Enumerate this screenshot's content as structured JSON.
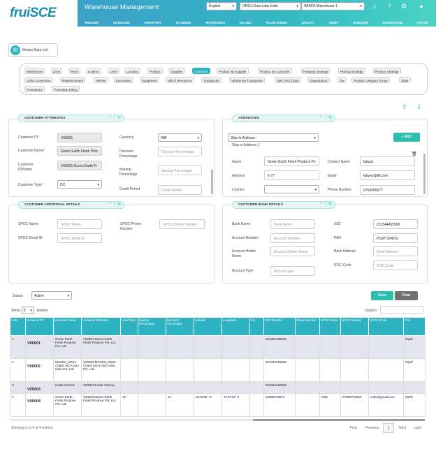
{
  "header": {
    "logo": "fruiSCE",
    "app_title": "Warehouse Management",
    "language": "English",
    "org": "ORG1:Data Labz India",
    "warehouse": "WH001:Warehouse 1",
    "nav": [
      "INBOUND",
      "OUTBOUND",
      "INVENTORY",
      "PLANNING",
      "WORKFORCE",
      "BILLING",
      "VALUE-ADDED",
      "QUALITY",
      "ASSET",
      "BARCODE",
      "INTEGRATION",
      "LAYOUT"
    ]
  },
  "master_data_list": "Master Data List",
  "tabs": [
    "Warehouse",
    "Zone",
    "Rack",
    "Column",
    "Level",
    "Location",
    "Product",
    "Supplier",
    "Customer",
    "Product By Supplier",
    "Product By Customer",
    "Putaway Strategy",
    "Picking Strategy",
    "Product Strategy",
    "UOM Conversion",
    "Replenishment",
    "Vehicle",
    "Executives",
    "Equipment",
    "Bill of Resources",
    "Transporter",
    "Vehicle By Transporter",
    "ABC-XYZ Class",
    "Organization",
    "Tax",
    "Product Category Group",
    "State",
    "Promotions",
    "Promotion Policy"
  ],
  "active_tab": "Customer",
  "customer_attributes": {
    "title": "CUSTOMER ATTRIBUTES",
    "customer_id_label": "Customer ID",
    "customer_id": "V00001",
    "customer_name_label": "Customer Name",
    "customer_name": "Green Earth Fresh Proc",
    "customer_idname_label": "Customer ID/Name",
    "customer_idname": "V00001:Green Earth Fr",
    "customer_type_label": "Customer Type",
    "customer_type": "DC",
    "currency_label": "Currency",
    "currency": "INR",
    "discount_label": "Discount Percentage",
    "discount_placeholder": "Discount Percentage",
    "markup_label": "Markup Percentage",
    "markup_placeholder": "Markup Percentage",
    "credit_label": "Credit Period",
    "credit_placeholder": "Credit Period"
  },
  "addresses": {
    "title": "ADDRESSES",
    "ship_select": "Ship to Address",
    "add_btn": "+ ADD",
    "ship_heading": "Ship to Address 1:",
    "name_label": "Name",
    "name": "Green Earth Fresh Produce Pv",
    "address_label": "Address",
    "address": "6-77",
    "country_label": "Country",
    "contact_label": "Contact Name",
    "contact": "kalyan",
    "email_label": "Email",
    "email": "kalyan@dll.com",
    "phone_label": "Phone Number",
    "phone": "9766566577"
  },
  "additional": {
    "title": "CUSTOMER ADDITIONAL DETAILS",
    "spoc_name_label": "SPOC Name",
    "spoc_name_ph": "SPOC Name",
    "spoc_phone_label": "SPOC Phone Number",
    "spoc_phone_ph": "SPOC Phone Number",
    "spoc_email_label": "SPOC Email ID",
    "spoc_email_ph": "SPOC Email ID"
  },
  "bank": {
    "title": "CUSTOMER BANK DETAILS",
    "bank_name_label": "Bank Name",
    "bank_name_ph": "Bank Name",
    "account_number_label": "Account Number",
    "account_number_ph": "Account Number",
    "holder_label": "Account Holder Name",
    "holder_ph": "Account Holder Name",
    "type_label": "Account Type",
    "type_ph": "Account type",
    "gst_label": "GST",
    "gst": "223344455566",
    "pan_label": "PAN",
    "pan": "PQW7324DG",
    "address_label": "Bank Address",
    "address_ph": "Bank Address",
    "ifsc_label": "IFSC Code",
    "ifsc_ph": "IFSC Code"
  },
  "status": {
    "label": "Status:",
    "value": "Active"
  },
  "save": "Save",
  "clear": "Clear",
  "table": {
    "show": "Show",
    "entries_count": "5",
    "entries": "Entries",
    "search": "Search:",
    "columns": [
      "S.No",
      "Customer ID",
      "Customer Name",
      "Customer ID/Name",
      "Lead Time",
      "Markup Percentage",
      "Discount Percentage",
      "Latitude",
      "Longitude",
      "Pin",
      "GST Number",
      "Phone Number",
      "SPOC Name",
      "SPOC Number",
      "SPOC Email",
      "PAN"
    ],
    "rows": [
      [
        "1",
        "V00001",
        "Green Earth Fresh Produce Pvt. Ltd.",
        "V00001:Green Earth Fresh Produce Pvt. Ltd.",
        "",
        "",
        "",
        "",
        "",
        "",
        "223344455566",
        "",
        "",
        "",
        "",
        "PQW"
      ],
      [
        "2",
        "V00002",
        "MSSRS_Metro Chash and Carry India Pvt. Ltd.",
        "V00002:MSSRS_Metro Chash and Carry India Pvt. Ltd.",
        "",
        "",
        "",
        "",
        "",
        "",
        "223344455566",
        "",
        "",
        "",
        "",
        "PQW"
      ],
      [
        "3",
        "V00003",
        "Kodai Cheese",
        "V00003:Kodai Cheese",
        "",
        "",
        "",
        "",
        "",
        "",
        "223344455566",
        "",
        "",
        "",
        "",
        ""
      ],
      [
        "4",
        "V00004",
        "Green Earth Fresh Produce Pvt. Ltd.",
        "V00004:Green Earth Fresh Produce Pvt. Ltd.",
        "10",
        "",
        "12",
        "23.0225° N",
        "72.5714° E",
        "",
        "23658478674",
        "",
        "Mike",
        "07089764523",
        "mike@gmail.com",
        "QWE"
      ]
    ],
    "footer": "Showing 1 to 4 of 4 entries",
    "first": "First",
    "previous": "Previous",
    "page": "1",
    "next": "Next",
    "last": "Last"
  }
}
